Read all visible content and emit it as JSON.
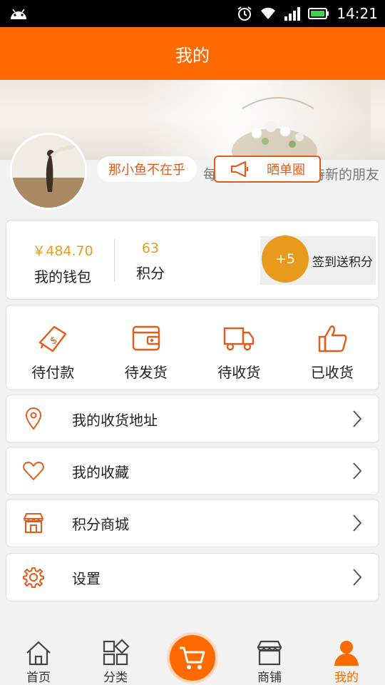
{
  "status_bar": {
    "time": "14:21"
  },
  "header": {
    "title": "我的"
  },
  "profile": {
    "nickname": "那小鱼不在乎",
    "share_label": "晒单圈",
    "tagline": "每一天，我们都期待新的朋友"
  },
  "wallet": {
    "balance_value": "￥484.70",
    "balance_label": "我的钱包",
    "points_value": "63",
    "points_label": "积分",
    "checkin_badge": "+5",
    "checkin_label": "签到送积分"
  },
  "orders": [
    {
      "label": "待付款",
      "icon": "money-tag-icon"
    },
    {
      "label": "待发货",
      "icon": "wallet-icon"
    },
    {
      "label": "待收货",
      "icon": "truck-icon"
    },
    {
      "label": "已收货",
      "icon": "thumbs-up-icon"
    }
  ],
  "menu": [
    {
      "label": "我的收货地址",
      "icon": "location-pin-icon"
    },
    {
      "label": "我的收藏",
      "icon": "heart-icon"
    },
    {
      "label": "积分商城",
      "icon": "store-icon"
    },
    {
      "label": "设置",
      "icon": "gear-icon"
    }
  ],
  "tabbar": [
    {
      "label": "首页",
      "icon": "home-icon"
    },
    {
      "label": "分类",
      "icon": "category-icon"
    },
    {
      "label": "",
      "icon": "cart-icon"
    },
    {
      "label": "商铺",
      "icon": "shop-icon"
    },
    {
      "label": "我的",
      "icon": "person-icon"
    }
  ],
  "colors": {
    "brand": "#ff6a00",
    "accent": "#e25c1a",
    "gold": "#e89a1d"
  }
}
